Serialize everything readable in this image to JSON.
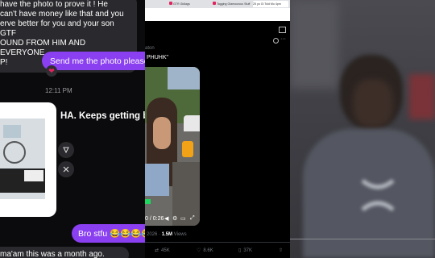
{
  "chat": {
    "incoming_message": "have the photo to prove it ! He can't have money like that and you deserve better for you and your son GTF AROUND FROM HIM AND EVERYONE :P!",
    "incoming_lines": [
      "have the photo to prove it ! He",
      "can't have money like that and you",
      "erve better for you and your son GTF",
      "OUND FROM HIM AND EVERYONE",
      "P!"
    ],
    "outgoing_1": "Send me the photo please 🫣",
    "heart_reaction": "❤",
    "timestamp": "12:11 PM",
    "photo_caption": "HA. Keeps getting better",
    "outgoing_2": "Bro stfu 😂😂😂😂",
    "last_message": "ma'am this was a month ago."
  },
  "browser": {
    "tabs": [
      "",
      "GTR Gidlags",
      "Tagging Glamourous Stuff",
      "25 yo Gi Told Mo 4pm"
    ],
    "active_tab_index": 3
  },
  "tweet": {
    "author_fragment": "aton",
    "text_fragment": "PHUHK\"",
    "video_time": "0:26",
    "time_shown": "0 / 0:26",
    "date_fragment": "2026",
    "views": "1.5M",
    "views_label": "Views",
    "retweets": "45K",
    "likes": "8.6K",
    "bookmarks": "37K"
  },
  "colors": {
    "chat_accent": "#8a3ff0",
    "chat_bg": "#0b0b0d",
    "bubble_in": "#2a2a2e",
    "twitter_bg": "#000000",
    "twitter_muted": "#71767b"
  }
}
